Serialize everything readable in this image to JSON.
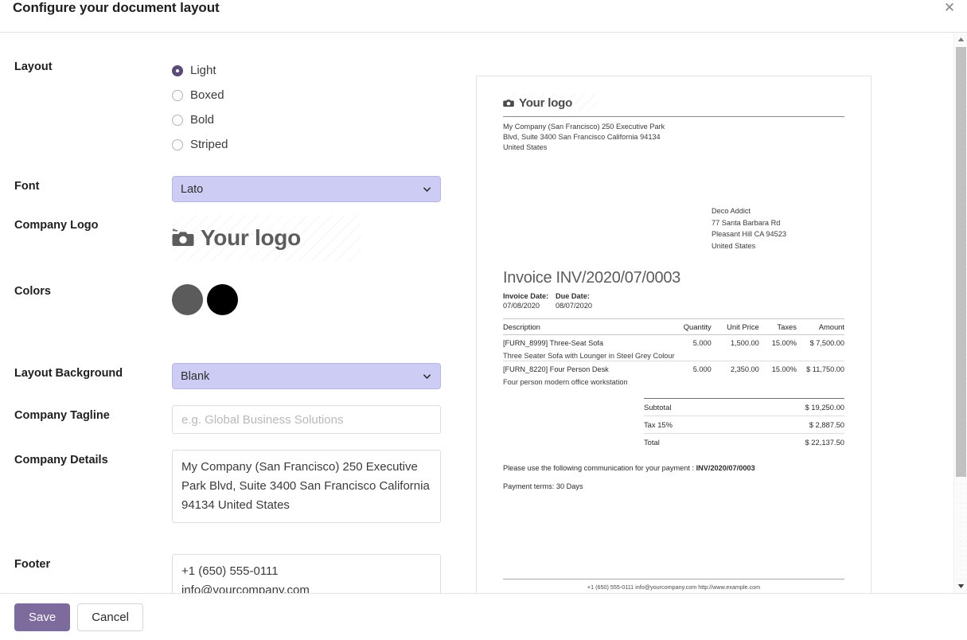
{
  "dialog": {
    "title": "Configure your document layout",
    "close_icon": "close-icon"
  },
  "form": {
    "layout": {
      "label": "Layout",
      "options": [
        "Light",
        "Boxed",
        "Bold",
        "Striped"
      ],
      "selected": "Light"
    },
    "font": {
      "label": "Font",
      "value": "Lato"
    },
    "company_logo": {
      "label": "Company Logo",
      "placeholder_text": "Your logo",
      "icon": "camera-plus-icon"
    },
    "colors": {
      "label": "Colors",
      "primary": "#5b5b5b",
      "secondary": "#000000"
    },
    "layout_background": {
      "label": "Layout Background",
      "value": "Blank"
    },
    "company_tagline": {
      "label": "Company Tagline",
      "value": "",
      "placeholder": "e.g. Global Business Solutions"
    },
    "company_details": {
      "label": "Company Details",
      "value": "My Company (San Francisco) 250 Executive Park Blvd, Suite 3400 San Francisco California 94134 United States"
    },
    "footer_field": {
      "label": "Footer",
      "value": "+1 (650) 555-0111\ninfo@yourcompany.com"
    }
  },
  "preview": {
    "logo_text": "Your logo",
    "logo_icon": "camera-icon",
    "company_address": "My Company (San Francisco) 250 Executive Park Blvd, Suite 3400 San Francisco California 94134 United States",
    "customer": [
      "Deco Addict",
      "77 Santa Barbara Rd",
      "Pleasant Hill CA 94523",
      "United States"
    ],
    "invoice_title": "Invoice INV/2020/07/0003",
    "dates": {
      "invoice_date_label": "Invoice Date:",
      "invoice_date_value": "07/08/2020",
      "due_date_label": "Due Date:",
      "due_date_value": "08/07/2020"
    },
    "table": {
      "headers": [
        "Description",
        "Quantity",
        "Unit Price",
        "Taxes",
        "Amount"
      ],
      "rows": [
        {
          "description": "[FURN_8999] Three-Seat Sofa",
          "description2": "Three Seater Sofa with Lounger in Steel Grey Colour",
          "quantity": "5.000",
          "unit_price": "1,500.00",
          "taxes": "15.00%",
          "amount": "$ 7,500.00"
        },
        {
          "description": "[FURN_8220] Four Person Desk",
          "description2": "Four person modern office workstation",
          "quantity": "5.000",
          "unit_price": "2,350.00",
          "taxes": "15.00%",
          "amount": "$ 11,750.00"
        }
      ]
    },
    "totals": [
      {
        "label": "Subtotal",
        "value": "$ 19,250.00"
      },
      {
        "label": "Tax 15%",
        "value": "$ 2,887.50"
      },
      {
        "label": "Total",
        "value": "$ 22,137.50"
      }
    ],
    "payment_note_prefix": "Please use the following communication for your payment : ",
    "payment_note_ref": "INV/2020/07/0003",
    "payment_terms": "Payment terms: 30 Days",
    "doc_footer": "+1 (650) 555-0111 info@yourcompany.com http://www.example.com"
  },
  "footer": {
    "save_label": "Save",
    "cancel_label": "Cancel"
  }
}
